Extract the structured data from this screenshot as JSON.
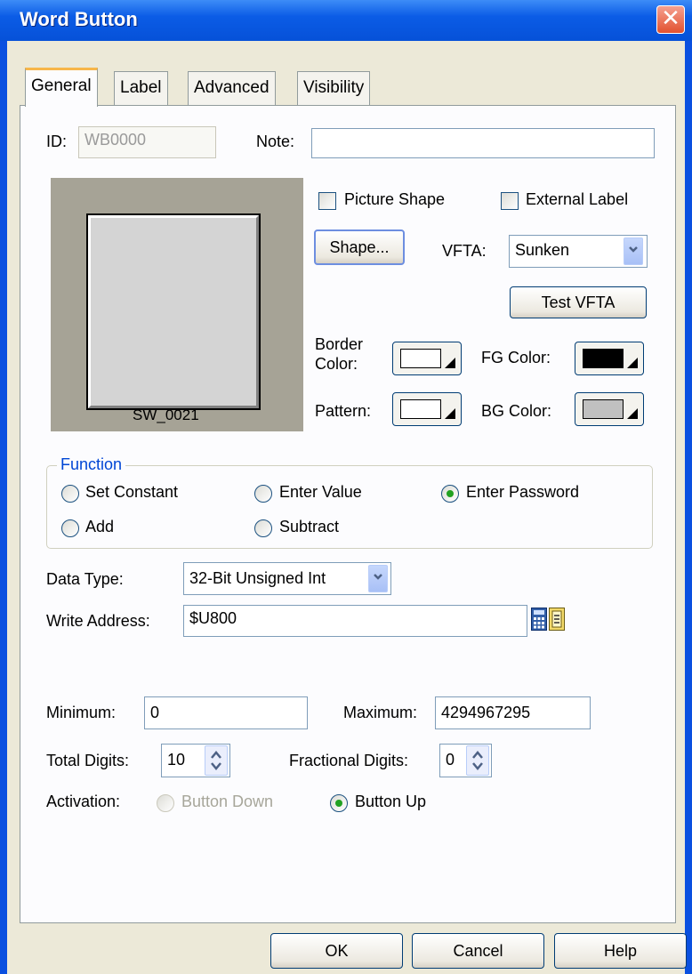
{
  "window": {
    "title": "Word Button",
    "close_glyph": "✕"
  },
  "tabs": [
    {
      "label": "General",
      "active": true
    },
    {
      "label": "Label",
      "active": false
    },
    {
      "label": "Advanced",
      "active": false
    },
    {
      "label": "Visibility",
      "active": false
    }
  ],
  "general": {
    "id_label": "ID:",
    "id_value": "WB0000",
    "note_label": "Note:",
    "note_value": "",
    "preview_caption": "SW_0021",
    "picture_shape_label": "Picture Shape",
    "external_label_label": "External Label",
    "shape_button": "Shape...",
    "vfta_label": "VFTA:",
    "vfta_value": "Sunken",
    "test_vfta_button": "Test VFTA",
    "border_color_label": "Border Color:",
    "fg_color_label": "FG Color:",
    "pattern_label": "Pattern:",
    "bg_color_label": "BG Color:",
    "colors": {
      "border": "#ffffff",
      "fg": "#000000",
      "pattern": "#ffffff",
      "bg": "#c0c0c0"
    }
  },
  "function": {
    "legend": "Function",
    "options": [
      {
        "label": "Set Constant",
        "selected": false
      },
      {
        "label": "Enter Value",
        "selected": false
      },
      {
        "label": "Enter Password",
        "selected": true
      },
      {
        "label": "Add",
        "selected": false
      },
      {
        "label": "Subtract",
        "selected": false
      }
    ]
  },
  "data": {
    "data_type_label": "Data Type:",
    "data_type_value": "32-Bit Unsigned Int",
    "write_address_label": "Write Address:",
    "write_address_value": "$U800",
    "minimum_label": "Minimum:",
    "minimum_value": "0",
    "maximum_label": "Maximum:",
    "maximum_value": "4294967295",
    "total_digits_label": "Total Digits:",
    "total_digits_value": "10",
    "fractional_digits_label": "Fractional Digits:",
    "fractional_digits_value": "0",
    "activation_label": "Activation:",
    "button_down_label": "Button Down",
    "button_up_label": "Button Up"
  },
  "footer": {
    "ok": "OK",
    "cancel": "Cancel",
    "help": "Help"
  }
}
